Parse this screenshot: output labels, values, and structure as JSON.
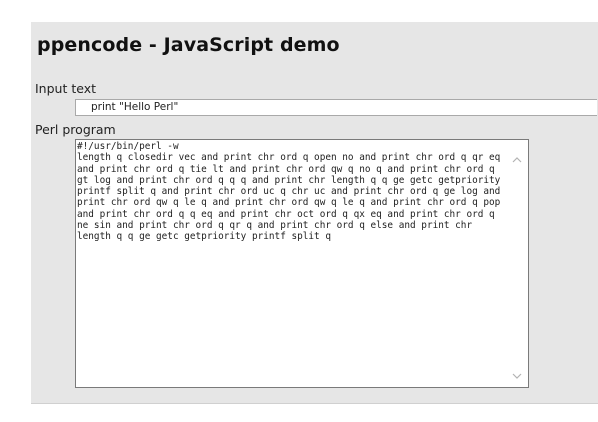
{
  "page": {
    "title": "ppencode - JavaScript demo"
  },
  "input": {
    "label": "Input text",
    "value": "print \"Hello Perl\""
  },
  "perl": {
    "label": "Perl program",
    "code": "#!/usr/bin/perl -w\nlength q closedir vec and print chr ord q open no and print chr ord q qr eq and print chr ord q tie lt and print chr ord qw q no q and print chr ord q gt log and print chr ord q q q and print chr length q q ge getc getpriority printf split q and print chr ord uc q chr uc and print chr ord q ge log and print chr ord qw q le q and print chr ord qw q le q and print chr ord q pop and print chr ord q q eq and print chr oct ord q qx eq and print chr ord q ne sin and print chr ord q qr q and print chr ord q else and print chr length q q ge getc getpriority printf split q"
  },
  "icons": {
    "scroll_up": "chevron-up-icon",
    "scroll_down": "chevron-down-icon"
  },
  "colors": {
    "panel_background": "#e6e6e6",
    "field_border": "#a9a9a9",
    "textarea_border": "#7a7a7a"
  }
}
